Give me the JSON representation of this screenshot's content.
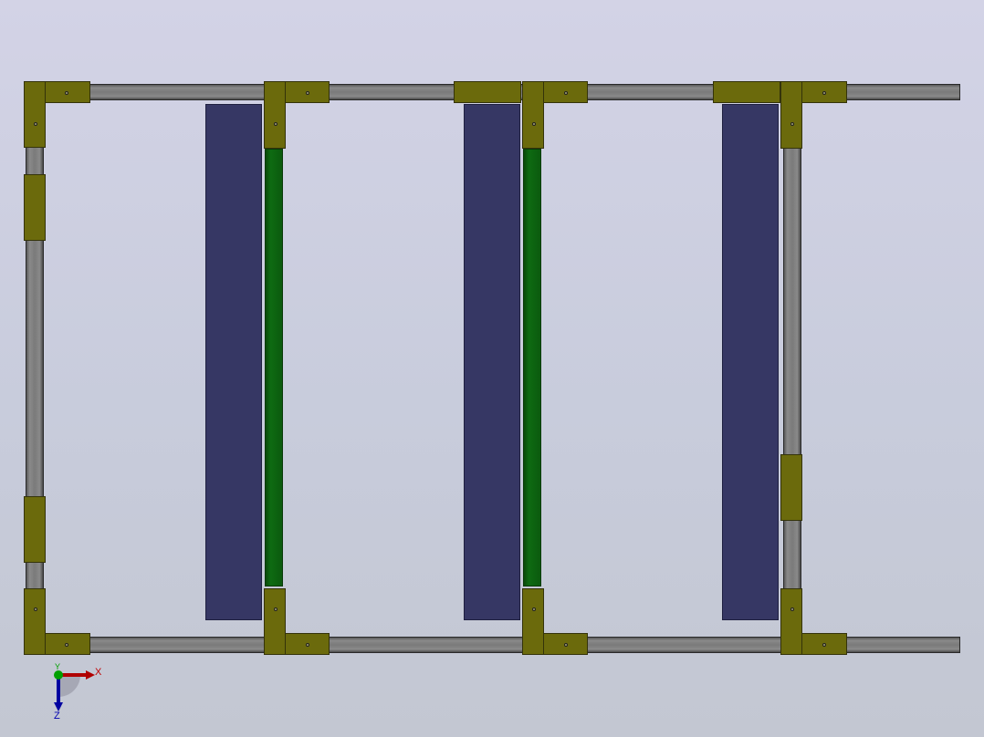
{
  "viewport": {
    "background_top": "#d3d3e6",
    "background_bottom": "#c3c7d2"
  },
  "model": {
    "colors": {
      "rail": "#7a7a7a",
      "bracket": "#6b6a0c",
      "panel": "#363764",
      "strip": "#0e6b12"
    }
  },
  "triad": {
    "x_label": "X",
    "y_label": "Y",
    "z_label": "Z",
    "x_color": "#c00000",
    "y_color": "#00a000",
    "z_color": "#0000b0"
  }
}
